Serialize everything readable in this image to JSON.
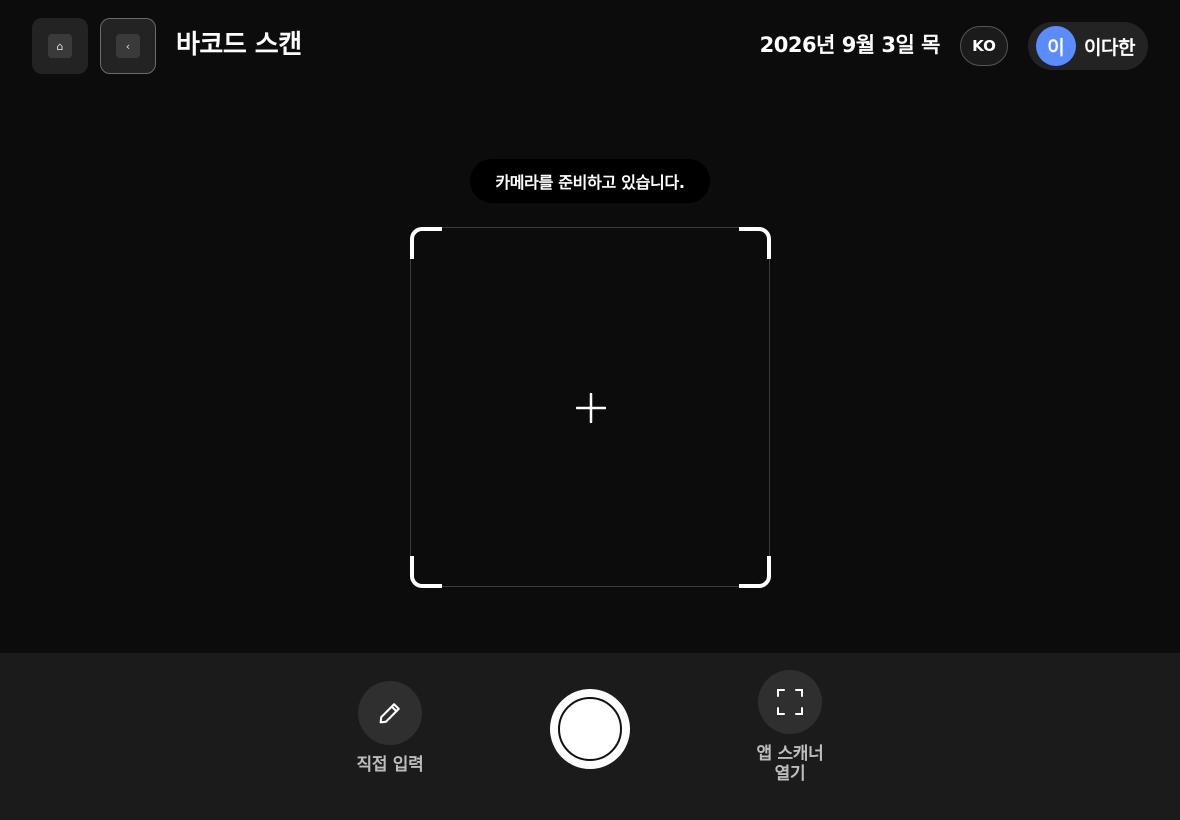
{
  "header": {
    "home_icon": "home-icon",
    "home_glyph": "⌂",
    "back_icon": "chevron-left-icon",
    "back_glyph": "‹",
    "title": "바코드 스캔",
    "date": "2026년 9월 3일 목",
    "language": "KO",
    "user": {
      "avatar_initial": "이",
      "name": "이다한",
      "avatar_color": "#5b8cff"
    }
  },
  "scanner": {
    "status_text": "카메라를 준비하고 있습니다.",
    "crosshair_icon": "plus-icon"
  },
  "bottom_bar": {
    "manual_entry": {
      "icon": "pencil-icon",
      "label": "직접 입력"
    },
    "shutter": {
      "icon": "shutter-icon"
    },
    "app_scanner": {
      "icon": "scan-frame-icon",
      "label": "앱 스캐너 열기"
    }
  },
  "colors": {
    "background": "#0c0c0c",
    "bottom_bar": "#1b1b1b",
    "accent": "#5b8cff"
  }
}
